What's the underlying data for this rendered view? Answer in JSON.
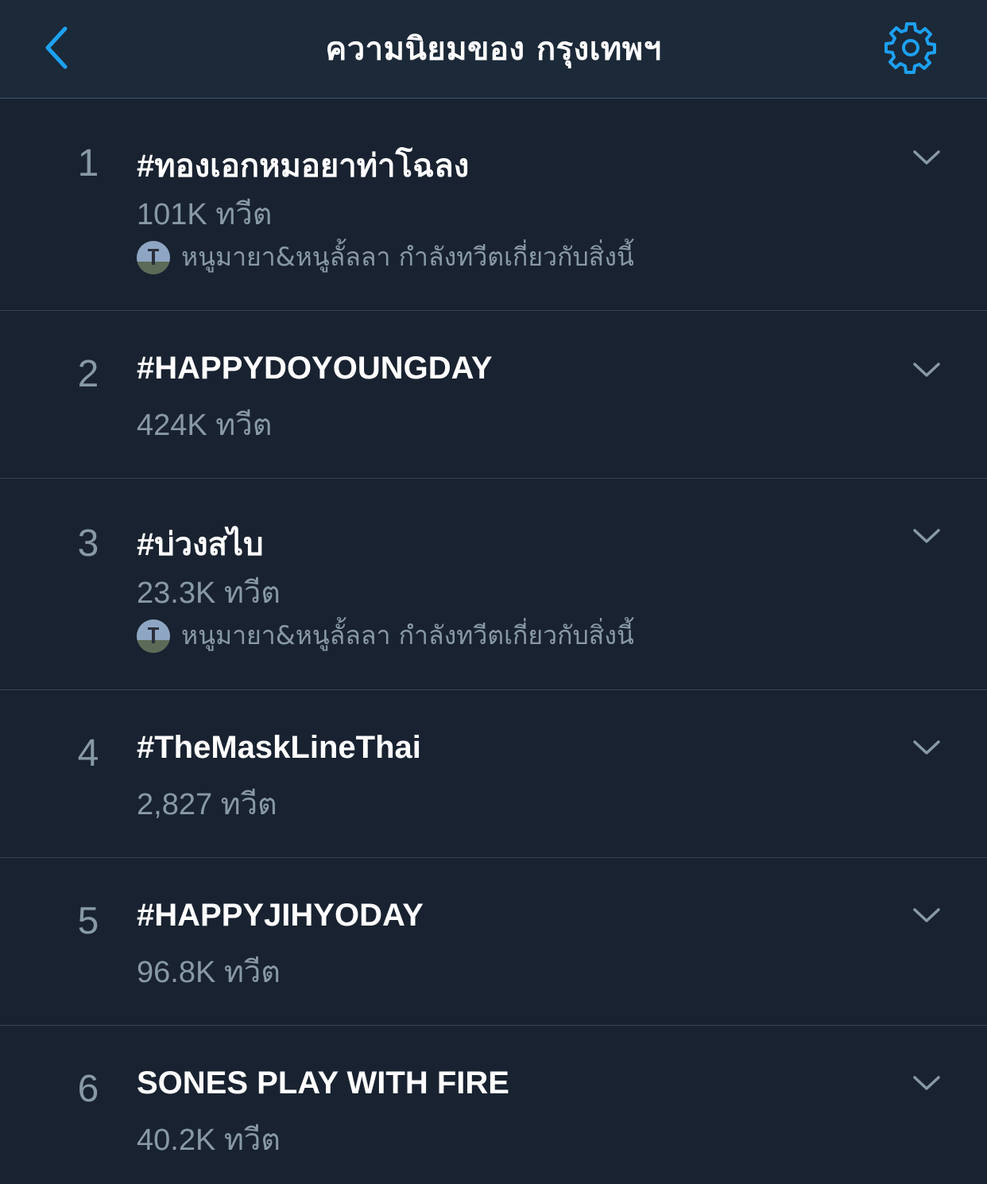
{
  "header": {
    "title": "ความนิยมของ กรุงเทพฯ",
    "back_icon": "chevron-left-icon",
    "settings_icon": "gear-icon",
    "accent_color": "#1da1f2"
  },
  "trends": [
    {
      "rank": "1",
      "name": "#ทองเอกหมอยาท่าโฉลง",
      "count": "101K ทวีต",
      "tweeting": "หนูมายา&หนูลั้ลลา กำลังทวีตเกี่ยวกับสิ่งนี้"
    },
    {
      "rank": "2",
      "name": "#HAPPYDOYOUNGDAY",
      "count": "424K ทวีต"
    },
    {
      "rank": "3",
      "name": "#บ่วงสไบ",
      "count": "23.3K ทวีต",
      "tweeting": "หนูมายา&หนูลั้ลลา กำลังทวีตเกี่ยวกับสิ่งนี้"
    },
    {
      "rank": "4",
      "name": "#TheMaskLineThai",
      "count": "2,827 ทวีต"
    },
    {
      "rank": "5",
      "name": "#HAPPYJIHYODAY",
      "count": "96.8K ทวีต"
    },
    {
      "rank": "6",
      "name": "SONES PLAY WITH FIRE",
      "count": "40.2K ทวีต"
    }
  ],
  "colors": {
    "background": "#15202b",
    "row_background": "#192230",
    "header_background": "#1c2938",
    "secondary_text": "#8899a6",
    "divider": "#38444d"
  }
}
